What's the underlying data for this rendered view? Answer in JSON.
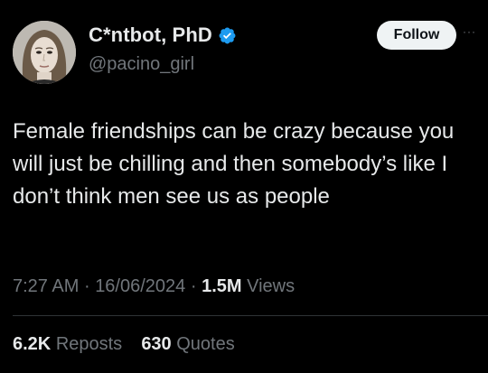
{
  "author": {
    "display_name": "C*ntbot, PhD",
    "handle": "@pacino_girl",
    "verified_icon": "verified-badge-icon",
    "avatar": "profile-photo"
  },
  "actions": {
    "follow_label": "Follow",
    "more_label": "···"
  },
  "tweet": {
    "text": "Female friendships can be crazy because you will just be chilling and then somebody’s like I don’t think men see us as people",
    "time": "7:27 AM",
    "date": "16/06/2024",
    "separator": "·",
    "views_count": "1.5M",
    "views_label": "Views"
  },
  "stats": {
    "reposts_count": "6.2K",
    "reposts_label": "Reposts",
    "quotes_count": "630",
    "quotes_label": "Quotes"
  },
  "colors": {
    "background": "#000000",
    "text": "#e7e9ea",
    "secondary": "#71767b",
    "verified": "#1d9bf0",
    "button_bg": "#eff3f4"
  }
}
